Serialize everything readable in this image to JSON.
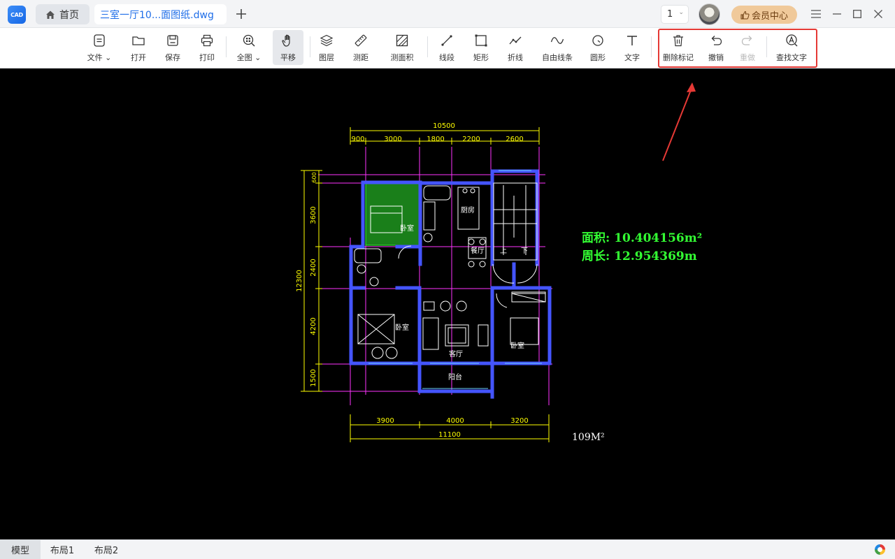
{
  "app": {
    "logo_text": "CAD"
  },
  "tabs": [
    {
      "label": "首页"
    },
    {
      "label": "三室一厅10...面图纸.dwg"
    }
  ],
  "titlebar": {
    "page_select": "1",
    "vip_label": "会员中心"
  },
  "toolbar": {
    "file": "文件",
    "open": "打开",
    "save": "保存",
    "print": "打印",
    "fit_all": "全图",
    "pan": "平移",
    "layers": "图层",
    "measure_distance": "测距",
    "measure_area": "测面积",
    "line_segment": "线段",
    "rectangle": "矩形",
    "polyline": "折线",
    "freehand": "自由线条",
    "circle": "圆形",
    "text": "文字",
    "delete_markup": "删除标记",
    "undo": "撤销",
    "redo": "重做",
    "find_text": "查找文字"
  },
  "drawing": {
    "dims_top": {
      "total": "10500",
      "segments": [
        "900",
        "3000",
        "1800",
        "2200",
        "2600"
      ]
    },
    "dims_left": {
      "total": "12300",
      "segments": [
        "600",
        "3600",
        "2400",
        "4200",
        "1500"
      ]
    },
    "dims_bottom": {
      "total": "11100",
      "segments": [
        "3900",
        "4000",
        "3200"
      ]
    },
    "rooms": {
      "bedroom": "卧室",
      "kitchen": "厨房",
      "dining": "餐厅",
      "living": "客厅",
      "balcony": "阳台",
      "up": "上",
      "down": "下"
    },
    "area_label": "面积: 10.404156m²",
    "perimeter_label": "周长: 12.954369m",
    "size_note": "109M²"
  },
  "status": {
    "layouts": [
      "模型",
      "布局1",
      "布局2"
    ]
  },
  "colors": {
    "canvas_bg": "#000000",
    "wall": "#4455ff",
    "dimension": "#ffff00",
    "axis": "#ff00ff",
    "furniture": "#ffffff",
    "measure_text": "#00ff00",
    "selection_fill": "#1f7a1f",
    "highlight": "#e53935",
    "brand": "#1f6ee8"
  }
}
